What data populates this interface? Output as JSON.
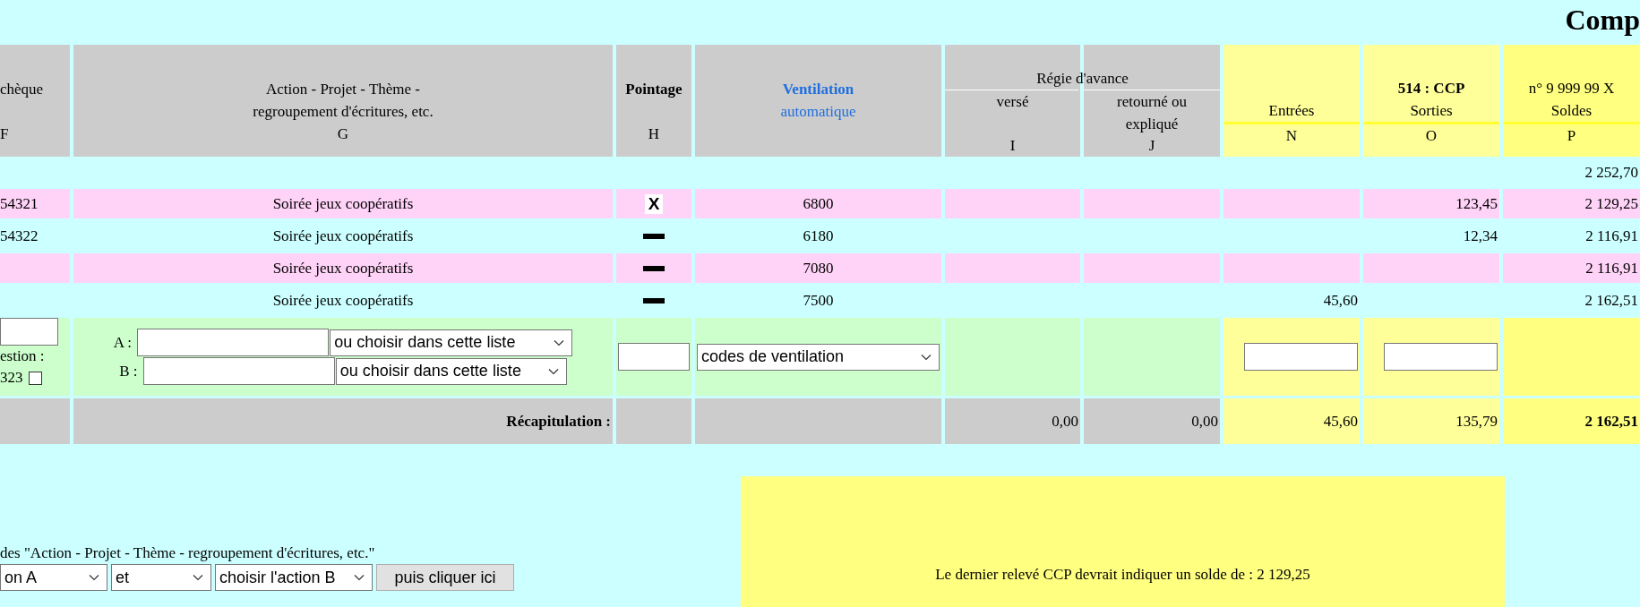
{
  "title": "Comp",
  "header": {
    "col_f": {
      "label": "chèque",
      "letter": "F"
    },
    "col_g": {
      "label_lines": [
        "Action - Projet - Thème -",
        "regroupement d'écritures, etc."
      ],
      "letter": "G"
    },
    "col_h": {
      "label": "Pointage",
      "letter": "H"
    },
    "ventilation": {
      "label": "Ventilation",
      "sublabel": "automatique"
    },
    "regie": {
      "label": "Régie d'avance",
      "verse": {
        "label": "versé",
        "letter": "I"
      },
      "retourne": {
        "label": "retourné ou expliqué",
        "letter": "J"
      }
    },
    "account": {
      "code": "514 : CCP",
      "number": "n° 9 999 99 X",
      "entrees": {
        "label": "Entrées",
        "letter": "N"
      },
      "sorties": {
        "label": "Sorties",
        "letter": "O"
      },
      "soldes": {
        "label": "Soldes",
        "letter": "P"
      }
    }
  },
  "opening_balance": "2 252,70",
  "rows": [
    {
      "shaded": true,
      "cheque": "54321",
      "action": "Soirée jeux coopératifs",
      "pointage": {
        "kind": "mark",
        "text": "X"
      },
      "ventilation": "6800",
      "sorties": "123,45",
      "solde": "2 129,25"
    },
    {
      "shaded": false,
      "cheque": "54322",
      "action": "Soirée jeux coopératifs",
      "pointage": {
        "kind": "dash"
      },
      "ventilation": "6180",
      "sorties": "12,34",
      "solde": "2 116,91"
    },
    {
      "shaded": true,
      "action": "Soirée jeux coopératifs",
      "pointage": {
        "kind": "dash"
      },
      "ventilation": "7080",
      "solde": "2 116,91"
    },
    {
      "shaded": false,
      "action": "Soirée jeux coopératifs",
      "pointage": {
        "kind": "dash"
      },
      "ventilation": "7500",
      "entrees": "45,60",
      "solde": "2 162,51"
    }
  ],
  "entry_form": {
    "question_label": "estion :",
    "code": "323",
    "checked": false,
    "action_a": {
      "label": "A :",
      "choice": "ou choisir dans cette liste"
    },
    "action_b": {
      "label": "B :",
      "choice": "ou choisir dans cette liste"
    },
    "ventilation_choice": "codes de ventilation"
  },
  "recap": {
    "label": "Récapitulation :",
    "verse": "0,00",
    "retourne": "0,00",
    "entrees": "45,60",
    "sorties": "135,79",
    "solde": "2 162,51"
  },
  "filter": {
    "label": "des \"Action - Projet - Thème - regroupement d'écritures, etc.\"",
    "select_a": "on A",
    "operator": "et",
    "select_b": "choisir l'action B",
    "button": "puis cliquer ici"
  },
  "notice": "Le dernier relevé CCP devrait indiquer un solde de : 2 129,25"
}
